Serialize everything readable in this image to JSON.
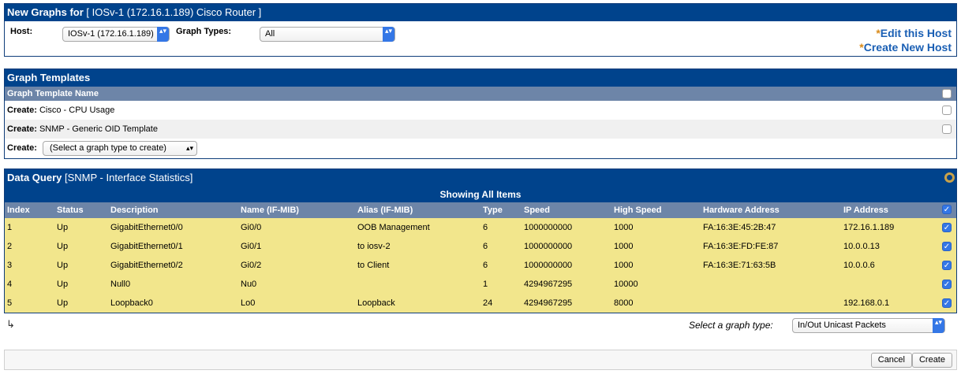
{
  "host_panel": {
    "title_bold": "New Graphs for",
    "title_rest": "[ IOSv-1 (172.16.1.189) Cisco Router ]",
    "host_label": "Host:",
    "host_value": "IOSv-1 (172.16.1.189)",
    "graph_types_label": "Graph Types:",
    "graph_types_value": "All",
    "edit_host": "Edit this Host",
    "create_host": "Create New Host",
    "star": "*"
  },
  "templates": {
    "title": "Graph Templates",
    "column": "Graph Template Name",
    "rows": [
      {
        "prefix": "Create:",
        "name": "Cisco - CPU Usage"
      },
      {
        "prefix": "Create:",
        "name": "SNMP - Generic OID Template"
      }
    ],
    "create_label": "Create:",
    "create_select": "(Select a graph type to create)"
  },
  "data_query": {
    "title_bold": "Data Query",
    "title_rest": "[SNMP - Interface Statistics]",
    "showing": "Showing All Items",
    "columns": [
      "Index",
      "Status",
      "Description",
      "Name (IF-MIB)",
      "Alias (IF-MIB)",
      "Type",
      "Speed",
      "High Speed",
      "Hardware Address",
      "IP Address"
    ],
    "rows": [
      [
        "1",
        "Up",
        "GigabitEthernet0/0",
        "Gi0/0",
        "OOB Management",
        "6",
        "1000000000",
        "1000",
        "FA:16:3E:45:2B:47",
        "172.16.1.189"
      ],
      [
        "2",
        "Up",
        "GigabitEthernet0/1",
        "Gi0/1",
        "to iosv-2",
        "6",
        "1000000000",
        "1000",
        "FA:16:3E:FD:FE:87",
        "10.0.0.13"
      ],
      [
        "3",
        "Up",
        "GigabitEthernet0/2",
        "Gi0/2",
        "to Client",
        "6",
        "1000000000",
        "1000",
        "FA:16:3E:71:63:5B",
        "10.0.0.6"
      ],
      [
        "4",
        "Up",
        "Null0",
        "Nu0",
        "",
        "1",
        "4294967295",
        "10000",
        "",
        ""
      ],
      [
        "5",
        "Up",
        "Loopback0",
        "Lo0",
        "Loopback",
        "24",
        "4294967295",
        "8000",
        "",
        "192.168.0.1"
      ]
    ],
    "select_graph_type_label": "Select a graph type:",
    "select_graph_type_value": "In/Out Unicast Packets",
    "check_mark": "✓"
  },
  "footer": {
    "cancel": "Cancel",
    "create": "Create"
  },
  "icons": {
    "select_arrow": "▴▾",
    "corner_arrow": "↳"
  }
}
